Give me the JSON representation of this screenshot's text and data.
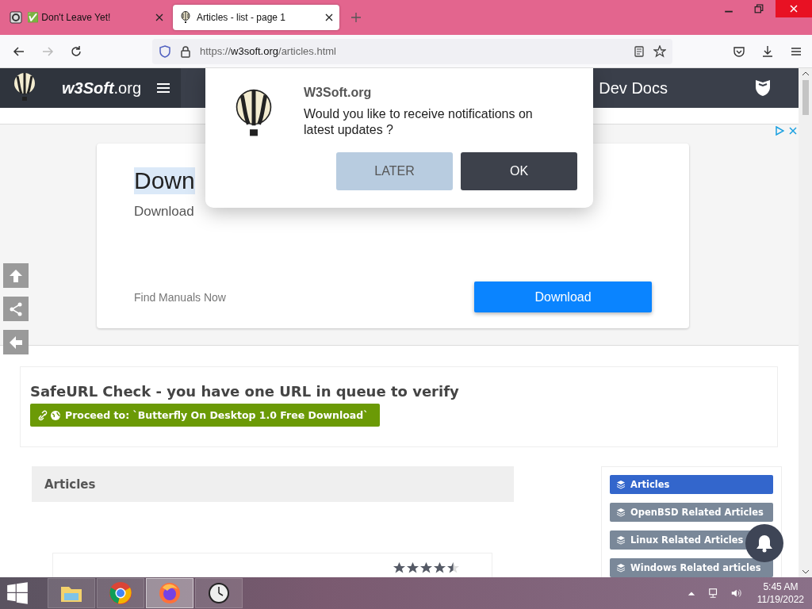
{
  "browser": {
    "tabs": [
      {
        "title": "✅ Don't Leave Yet!",
        "selected": false
      },
      {
        "title": "Articles - list - page 1",
        "selected": true
      }
    ],
    "url": {
      "scheme": "https://",
      "host": "w3soft.org",
      "path": "/articles.html"
    }
  },
  "site_header": {
    "logo_bold": "w3Soft",
    "logo_rest": ".org",
    "section": "Dev Docs"
  },
  "notification_popup": {
    "title": "W3Soft.org",
    "message": "Would you like to receive notifications on latest updates ?",
    "buttons": [
      {
        "label": "LATER",
        "kind": "secondary"
      },
      {
        "label": "OK",
        "kind": "primary"
      }
    ]
  },
  "ad": {
    "heading": "Down",
    "subheading": "Download",
    "footer": "Find Manuals Now",
    "button": "Download"
  },
  "safeurl": {
    "title": "SafeURL Check - you have one URL in queue to verify",
    "link": "Proceed to: `Butterfly On Desktop 1.0 Free Download`"
  },
  "articles": {
    "heading": "Articles",
    "first_article": {
      "stars": 4.5
    }
  },
  "sidebar": {
    "items": [
      {
        "label": "Articles",
        "selected": true
      },
      {
        "label": "OpenBSD Related Articles",
        "selected": false
      },
      {
        "label": "Linux Related Articles",
        "selected": false
      },
      {
        "label": "Windows Related articles",
        "selected": false
      }
    ]
  },
  "taskbar": {
    "apps": [
      {
        "kind": "explorer",
        "selected": false
      },
      {
        "kind": "chrome",
        "selected": false
      },
      {
        "kind": "firefox",
        "selected": true
      },
      {
        "kind": "clock",
        "selected": false
      }
    ],
    "time": "5:45 AM",
    "date": "11/19/2022"
  }
}
